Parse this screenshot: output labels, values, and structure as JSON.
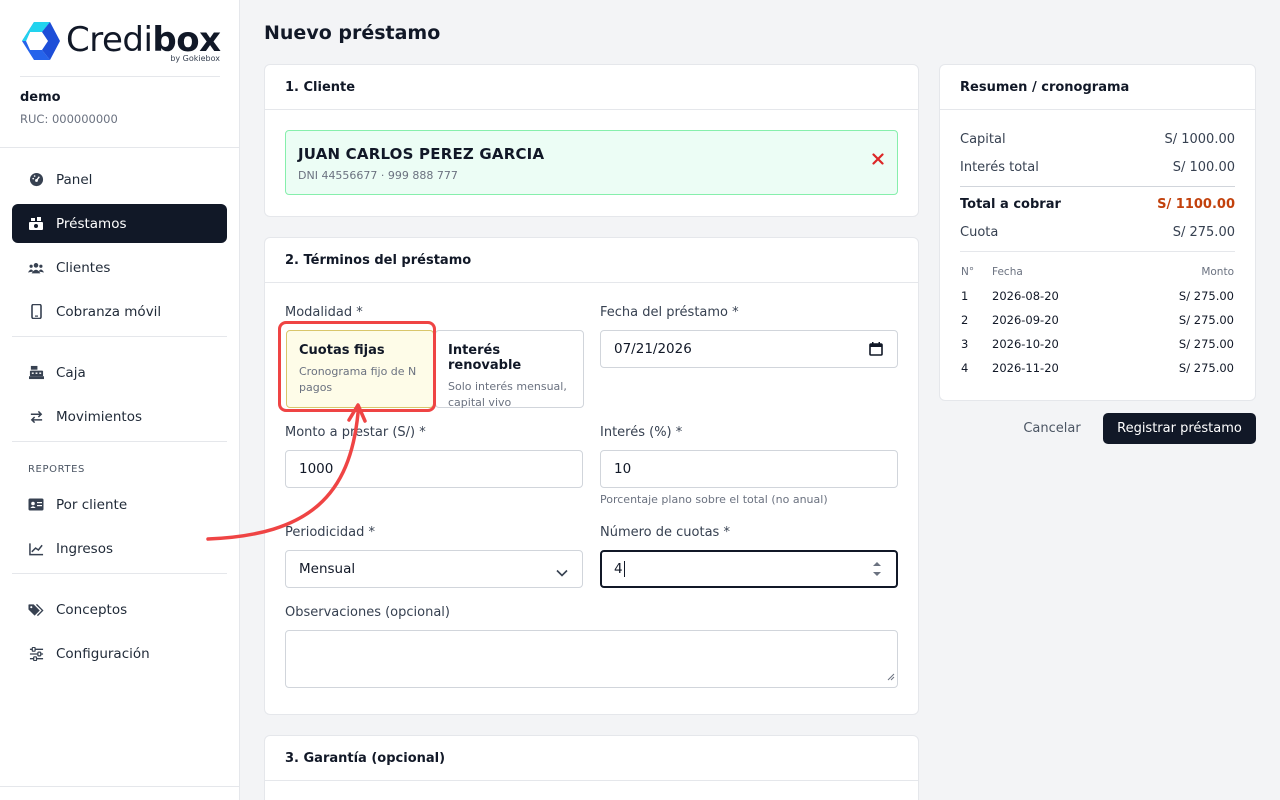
{
  "brand": {
    "name_part1": "Credi",
    "name_part2": "box",
    "byline": "by Gokiebox",
    "logo_colors": [
      "#22d3ee",
      "#2563eb"
    ]
  },
  "company": {
    "name": "demo",
    "ruc": "RUC: 000000000"
  },
  "nav": {
    "items": [
      {
        "label": "Panel",
        "icon": "dashboard-icon"
      },
      {
        "label": "Préstamos",
        "icon": "money-bag-icon",
        "active": true
      },
      {
        "label": "Clientes",
        "icon": "users-icon"
      },
      {
        "label": "Cobranza móvil",
        "icon": "mobile-icon"
      },
      {
        "label": "Caja",
        "icon": "cash-register-icon"
      },
      {
        "label": "Movimientos",
        "icon": "transfer-icon"
      },
      {
        "label": "Por cliente",
        "icon": "id-card-icon"
      },
      {
        "label": "Ingresos",
        "icon": "line-chart-icon"
      },
      {
        "label": "Conceptos",
        "icon": "tags-icon"
      },
      {
        "label": "Configuración",
        "icon": "sliders-icon"
      }
    ],
    "group_reportes": "REPORTES"
  },
  "page": {
    "title": "Nuevo préstamo"
  },
  "client_card": {
    "title": "1. Cliente",
    "name": "JUAN CARLOS PEREZ GARCIA",
    "meta": "DNI 44556677 · 999 888 777"
  },
  "terms_card": {
    "title": "2. Términos del préstamo",
    "modalidad_label": "Modalidad *",
    "modes": [
      {
        "title": "Cuotas fijas",
        "desc": "Cronograma fijo de N pagos",
        "selected": true
      },
      {
        "title": "Interés renovable",
        "desc": "Solo interés mensual, capital vivo",
        "selected": false
      }
    ],
    "fecha_label": "Fecha del préstamo *",
    "fecha_value": "07/21/2026",
    "monto_label": "Monto a prestar (S/) *",
    "monto_value": "1000",
    "interes_label": "Interés (%) *",
    "interes_value": "10",
    "interes_help": "Porcentaje plano sobre el total (no anual)",
    "periodicidad_label": "Periodicidad *",
    "periodicidad_value": "Mensual",
    "cuotas_label": "Número de cuotas *",
    "cuotas_value": "4",
    "obs_label": "Observaciones (opcional)",
    "obs_value": ""
  },
  "guarantee_card": {
    "title": "3. Garantía (opcional)"
  },
  "summary": {
    "title": "Resumen / cronograma",
    "rows": [
      {
        "label": "Capital",
        "value": "S/ 1000.00"
      },
      {
        "label": "Interés total",
        "value": "S/ 100.00"
      },
      {
        "label": "Total a cobrar",
        "value": "S/ 1100.00"
      },
      {
        "label": "Cuota",
        "value": "S/ 275.00"
      }
    ],
    "total_color": "#c2410c",
    "schedule_headers": [
      "N°",
      "Fecha",
      "Monto"
    ],
    "schedule": [
      {
        "n": "1",
        "fecha": "2026-08-20",
        "monto": "S/ 275.00"
      },
      {
        "n": "2",
        "fecha": "2026-09-20",
        "monto": "S/ 275.00"
      },
      {
        "n": "3",
        "fecha": "2026-10-20",
        "monto": "S/ 275.00"
      },
      {
        "n": "4",
        "fecha": "2026-11-20",
        "monto": "S/ 275.00"
      }
    ]
  },
  "actions": {
    "cancel": "Cancelar",
    "submit": "Registrar préstamo"
  },
  "annotation": {
    "color": "#ef4444"
  }
}
